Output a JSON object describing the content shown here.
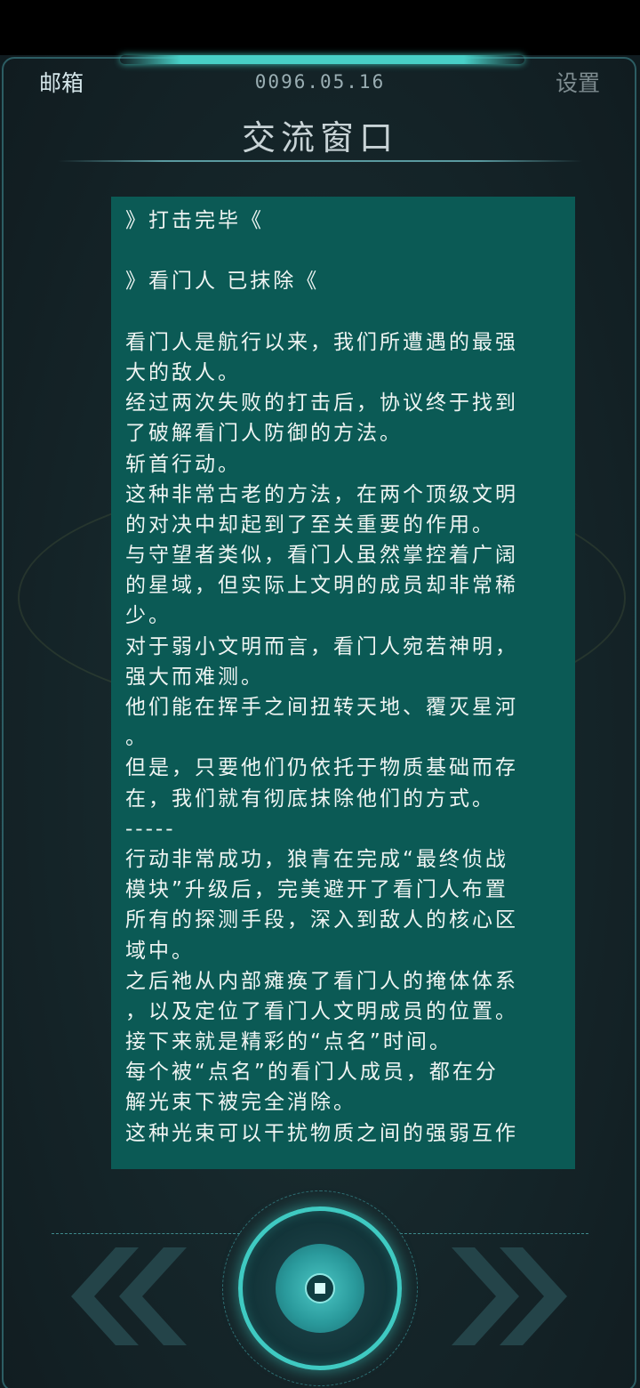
{
  "header": {
    "mailbox_label": "邮箱",
    "date": "0096.05.16",
    "settings_label": "设置",
    "title": "交流窗口"
  },
  "message": {
    "lines": [
      "》打击完毕《",
      "",
      "》看门人 已抹除《",
      "",
      "看门人是航行以来，我们所遭遇的最强",
      "大的敌人。",
      "经过两次失败的打击后，协议终于找到",
      "了破解看门人防御的方法。",
      "斩首行动。",
      "这种非常古老的方法，在两个顶级文明",
      "的对决中却起到了至关重要的作用。",
      "与守望者类似，看门人虽然掌控着广阔",
      "的星域，但实际上文明的成员却非常稀",
      "少。",
      "对于弱小文明而言，看门人宛若神明，",
      "强大而难测。",
      "他们能在挥手之间扭转天地、覆灭星河",
      "。",
      "但是，只要他们仍依托于物质基础而存",
      "在，我们就有彻底抹除他们的方式。",
      "-----",
      "行动非常成功，狼青在完成“最终侦战",
      "模块”升级后，完美避开了看门人布置",
      "所有的探测手段，深入到敌人的核心区",
      "域中。",
      "之后祂从内部瘫痪了看门人的掩体体系",
      "，以及定位了看门人文明成员的位置。",
      "接下来就是精彩的“点名”时间。",
      "每个被“点名”的看门人成员，都在分",
      "解光束下被完全消除。",
      "这种光束可以干扰物质之间的强弱互作",
      ""
    ]
  },
  "colors": {
    "panel_bg": "#0b5a55",
    "accent": "#3fcac2",
    "arrow": "#244449"
  },
  "controls": {
    "prev_icon": "double-chevron-left-icon",
    "center_icon": "target-button-icon",
    "next_icon": "double-chevron-right-icon"
  }
}
